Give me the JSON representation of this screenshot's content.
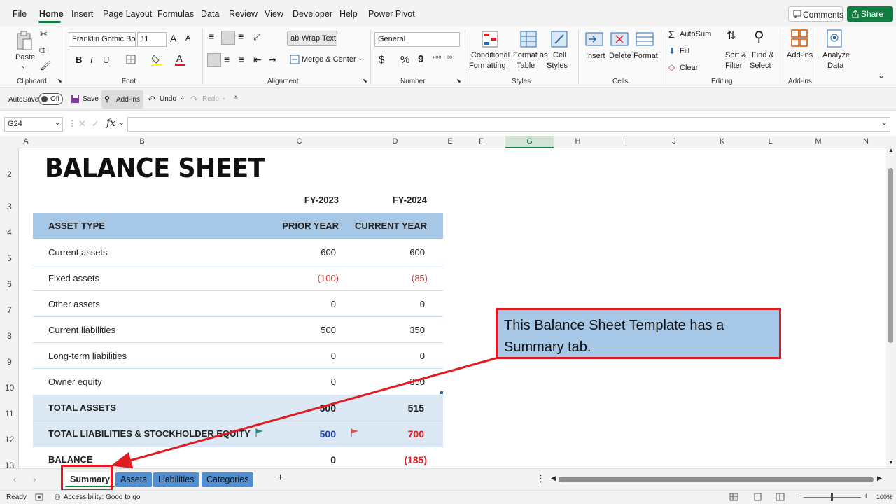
{
  "menu": {
    "items": [
      "File",
      "Home",
      "Insert",
      "Page Layout",
      "Formulas",
      "Data",
      "Review",
      "View",
      "Developer",
      "Help",
      "Power Pivot"
    ],
    "comments": "Comments",
    "share": "Share"
  },
  "ribbon": {
    "clipboard": {
      "paste": "Paste",
      "label": "Clipboard"
    },
    "font": {
      "name": "Franklin Gothic Boo",
      "size": "11",
      "bold": "B",
      "italic": "I",
      "underline": "U",
      "grow": "A",
      "shrink": "A",
      "label": "Font"
    },
    "alignment": {
      "wrap": "Wrap Text",
      "merge": "Merge & Center",
      "label": "Alignment"
    },
    "number": {
      "format": "General",
      "currency": "$",
      "percent": "%",
      "comma": "9",
      "label": "Number"
    },
    "styles": {
      "conditional": "Conditional",
      "conditional2": "Formatting",
      "formatas": "Format as",
      "formatas2": "Table",
      "cellstyles": "Cell",
      "cellstyles2": "Styles",
      "label": "Styles"
    },
    "cells": {
      "insert": "Insert",
      "delete": "Delete",
      "format": "Format",
      "label": "Cells"
    },
    "editing": {
      "autosum": "AutoSum",
      "fill": "Fill",
      "clear": "Clear",
      "sort": "Sort &",
      "sort2": "Filter",
      "find": "Find &",
      "find2": "Select",
      "label": "Editing"
    },
    "addins": {
      "addins": "Add-ins",
      "label": "Add-ins"
    },
    "analyze": {
      "line1": "Analyze",
      "line2": "Data"
    }
  },
  "qat": {
    "autosave": "AutoSave",
    "toggle": "Off",
    "save": "Save",
    "addins": "Add-ins",
    "undo": "Undo",
    "redo": "Redo"
  },
  "formula_bar": {
    "namebox": "G24",
    "fx": "fx",
    "formula": ""
  },
  "columns": [
    "A",
    "B",
    "C",
    "D",
    "E",
    "F",
    "G",
    "H",
    "I",
    "J",
    "K",
    "L",
    "M",
    "N"
  ],
  "rows": [
    "2",
    "3",
    "4",
    "5",
    "6",
    "7",
    "8",
    "9",
    "10",
    "11",
    "12",
    "13"
  ],
  "sheet": {
    "title": "BALANCE SHEET",
    "fy_prior": "FY-2023",
    "fy_current": "FY-2024",
    "header": {
      "type": "ASSET TYPE",
      "prior": "PRIOR YEAR",
      "current": "CURRENT YEAR"
    },
    "rows": [
      {
        "label": "Current assets",
        "prior": "600",
        "current": "600"
      },
      {
        "label": "Fixed assets",
        "prior": "(100)",
        "current": "(85)"
      },
      {
        "label": "Other assets",
        "prior": "0",
        "current": "0"
      },
      {
        "label": "Current liabilities",
        "prior": "500",
        "current": "350"
      },
      {
        "label": "Long-term liabilities",
        "prior": "0",
        "current": "0"
      },
      {
        "label": "Owner equity",
        "prior": "0",
        "current": "350"
      }
    ],
    "total_assets": {
      "label": "TOTAL ASSETS",
      "prior": "500",
      "current": "515"
    },
    "total_liab": {
      "label": "TOTAL LIABILITIES & STOCKHOLDER EQUITY",
      "prior": "500",
      "current": "700"
    },
    "balance": {
      "label": "BALANCE",
      "prior": "0",
      "current": "(185)"
    }
  },
  "callout": {
    "text": "This Balance Sheet Template has a Summary tab."
  },
  "tabs": [
    "Summary",
    "Assets",
    "Liabilities",
    "Categories"
  ],
  "add_sheet": "+",
  "status": {
    "ready": "Ready",
    "accessibility": "Accessibility: Good to go",
    "zoom": "100%"
  },
  "colors": {
    "accent": "#107c41",
    "header_blue": "#a7c7e7",
    "highlight_red": "#e11b22"
  }
}
